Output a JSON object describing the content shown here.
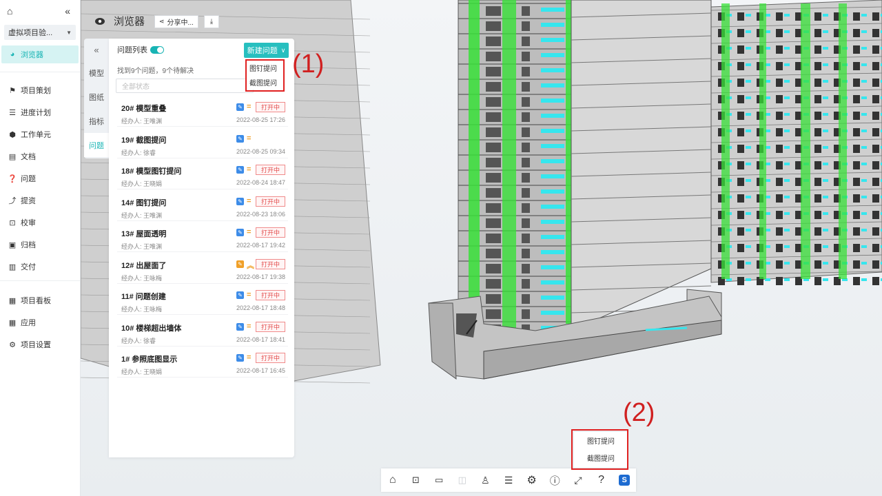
{
  "nav": {
    "project": "虚拟项目验...",
    "active": "浏览器",
    "groups": [
      [
        "项目策划",
        "进度计划",
        "工作单元",
        "文档",
        "问题",
        "提资",
        "校审",
        "归档",
        "交付"
      ],
      [
        "项目看板",
        "应用",
        "项目设置"
      ]
    ]
  },
  "viewer": {
    "title": "浏览器",
    "share": "分享中...",
    "tabs": [
      "模型",
      "图纸",
      "指标",
      "问题"
    ]
  },
  "issues": {
    "list_label": "问题列表",
    "new_button": "新建问题",
    "summary": "找到9个问题，9个待解决",
    "filter_placeholder": "全部状态",
    "items": [
      {
        "title": "20# 模型重叠",
        "assignee": "经办人: 王唯渊",
        "date": "2022-08-25 17:26",
        "status": "打开中",
        "priority": "normal"
      },
      {
        "title": "19# 截图提问",
        "assignee": "经办人: 徐睿",
        "date": "2022-08-25 09:34",
        "status": "",
        "priority": "none"
      },
      {
        "title": "18# 模型图钉提问",
        "assignee": "经办人: 王晓娟",
        "date": "2022-08-24 18:47",
        "status": "打开中",
        "priority": "normal"
      },
      {
        "title": "14# 图钉提问",
        "assignee": "经办人: 王唯渊",
        "date": "2022-08-23 18:06",
        "status": "打开中",
        "priority": "normal"
      },
      {
        "title": "13# 屋面透明",
        "assignee": "经办人: 王唯渊",
        "date": "2022-08-17 19:42",
        "status": "打开中",
        "priority": "normal"
      },
      {
        "title": "12# 出屋面了",
        "assignee": "经办人: 王咏梅",
        "date": "2022-08-17 19:38",
        "status": "打开中",
        "priority": "high"
      },
      {
        "title": "11# 问题创建",
        "assignee": "经办人: 王咏梅",
        "date": "2022-08-17 18:48",
        "status": "打开中",
        "priority": "normal"
      },
      {
        "title": "10# 楼梯超出墙体",
        "assignee": "经办人: 徐睿",
        "date": "2022-08-17 18:41",
        "status": "打开中",
        "priority": "normal"
      },
      {
        "title": "1# 参照底图显示",
        "assignee": "经办人: 王晓娟",
        "date": "2022-08-17 16:45",
        "status": "打开中",
        "priority": "normal"
      }
    ]
  },
  "new_menu": [
    "图钉提问",
    "截图提问"
  ],
  "toolbar_menu": [
    "图钉提问",
    "截图提问"
  ],
  "annotations": [
    "(1)",
    "(2)"
  ],
  "toolbar": [
    "home-icon",
    "zoom-box-icon",
    "ruler-icon",
    "section-icon",
    "person-icon",
    "list-icon",
    "settings-icon",
    "info-icon",
    "fullscreen-icon",
    "help-icon",
    "logo-icon"
  ],
  "colors": {
    "accent": "#27bfbf",
    "annotation": "#e02020",
    "status": "#e24a4a",
    "building_green": "#38e038",
    "window_cyan": "#36e6ee"
  }
}
